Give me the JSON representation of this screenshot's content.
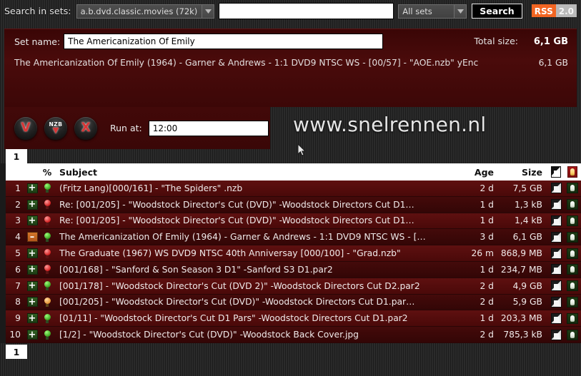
{
  "search": {
    "label": "Search in sets:",
    "set_selected": "a.b.dvd.classic.movies (72k)",
    "query_value": "",
    "query_placeholder": "",
    "scope_selected": "All sets",
    "button_label": "Search",
    "rss_label": "RSS",
    "rss_version": "2.0"
  },
  "set_panel": {
    "set_name_label": "Set name:",
    "set_name_value": "The Americanization Of Emily",
    "total_size_label": "Total size:",
    "total_size_value": "6,1 GB",
    "description": "The Americanization Of Emily (1964) - Garner & Andrews - 1:1 DVD9 NTSC WS - [00/57] - \"AOE.nzb\" yEnc",
    "description_size": "6,1 GB"
  },
  "actions": {
    "buttons": [
      {
        "name": "view-button",
        "glyph": "V"
      },
      {
        "name": "nzb-download-button",
        "top": "NZB",
        "glyph": "▼"
      },
      {
        "name": "cancel-button",
        "glyph": "X"
      }
    ],
    "run_at_label": "Run at:",
    "run_at_value": "12:00"
  },
  "brand": {
    "text": "www.snelrennen.nl"
  },
  "pager": {
    "top": "1",
    "bottom": "1"
  },
  "table": {
    "headers": {
      "num": "",
      "plus": "",
      "percent": "%",
      "subject": "Subject",
      "age": "Age",
      "size": "Size",
      "action_file": "file-icon",
      "action_bulb": "bulb-icon"
    },
    "rows": [
      {
        "num": "1",
        "tile": "add",
        "tile_glyph": "+",
        "bulb": "green",
        "subject": "(Fritz Lang)[000/161] - \"The Spiders\" .nzb",
        "age": "2 d",
        "size": "7,5 GB"
      },
      {
        "num": "2",
        "tile": "add",
        "tile_glyph": "+",
        "bulb": "red",
        "subject": "Re: [001/205] - \"Woodstock Director's Cut (DVD)\" -Woodstock Directors Cut D1…",
        "age": "1 d",
        "size": "1,3 kB"
      },
      {
        "num": "3",
        "tile": "add",
        "tile_glyph": "+",
        "bulb": "red",
        "subject": "Re: [001/205] - \"Woodstock Director's Cut (DVD)\" -Woodstock Directors Cut D1…",
        "age": "1 d",
        "size": "1,4 kB"
      },
      {
        "num": "4",
        "tile": "rem",
        "tile_glyph": "–",
        "bulb": "green",
        "subject": "The Americanization Of Emily (1964) - Garner & Andrews - 1:1 DVD9 NTSC WS - […",
        "age": "3 d",
        "size": "6,1 GB"
      },
      {
        "num": "5",
        "tile": "add",
        "tile_glyph": "+",
        "bulb": "red",
        "subject": "The Graduate (1967) WS DVD9 NTSC 40th Anniversay [000/100] - \"Grad.nzb\"",
        "age": "26 m",
        "size": "868,9 MB"
      },
      {
        "num": "6",
        "tile": "add",
        "tile_glyph": "+",
        "bulb": "red",
        "subject": "[001/168] - \"Sanford & Son Season 3 D1\" -Sanford S3 D1.par2",
        "age": "1 d",
        "size": "234,7 MB"
      },
      {
        "num": "7",
        "tile": "add",
        "tile_glyph": "+",
        "bulb": "green",
        "subject": "[001/178] - \"Woodstock Director's Cut (DVD 2)\" -Woodstock Directors Cut D2.par2",
        "age": "2 d",
        "size": "4,9 GB"
      },
      {
        "num": "8",
        "tile": "add",
        "tile_glyph": "+",
        "bulb": "orange",
        "subject": "[001/205] - \"Woodstock Director's Cut (DVD)\" -Woodstock Directors Cut D1.par…",
        "age": "2 d",
        "size": "5,9 GB"
      },
      {
        "num": "9",
        "tile": "add",
        "tile_glyph": "+",
        "bulb": "green",
        "subject": "[01/11] - \"Woodstock Director's Cut D1 Pars\" -Woodstock Directors Cut D1.par2",
        "age": "1 d",
        "size": "203,3 MB"
      },
      {
        "num": "10",
        "tile": "add",
        "tile_glyph": "+",
        "bulb": "green",
        "subject": "[1/2] - \"Woodstock Director's Cut (DVD)\" -Woodstock Back Cover.jpg",
        "age": "2 d",
        "size": "785,3 kB"
      }
    ]
  },
  "colors": {
    "background": "#262626",
    "panel_maroon": "#4a0b0b",
    "row_light": "#5e1010",
    "row_dark": "#440a0a",
    "accent_orange": "#f26522",
    "glyph_red": "#d93636"
  }
}
